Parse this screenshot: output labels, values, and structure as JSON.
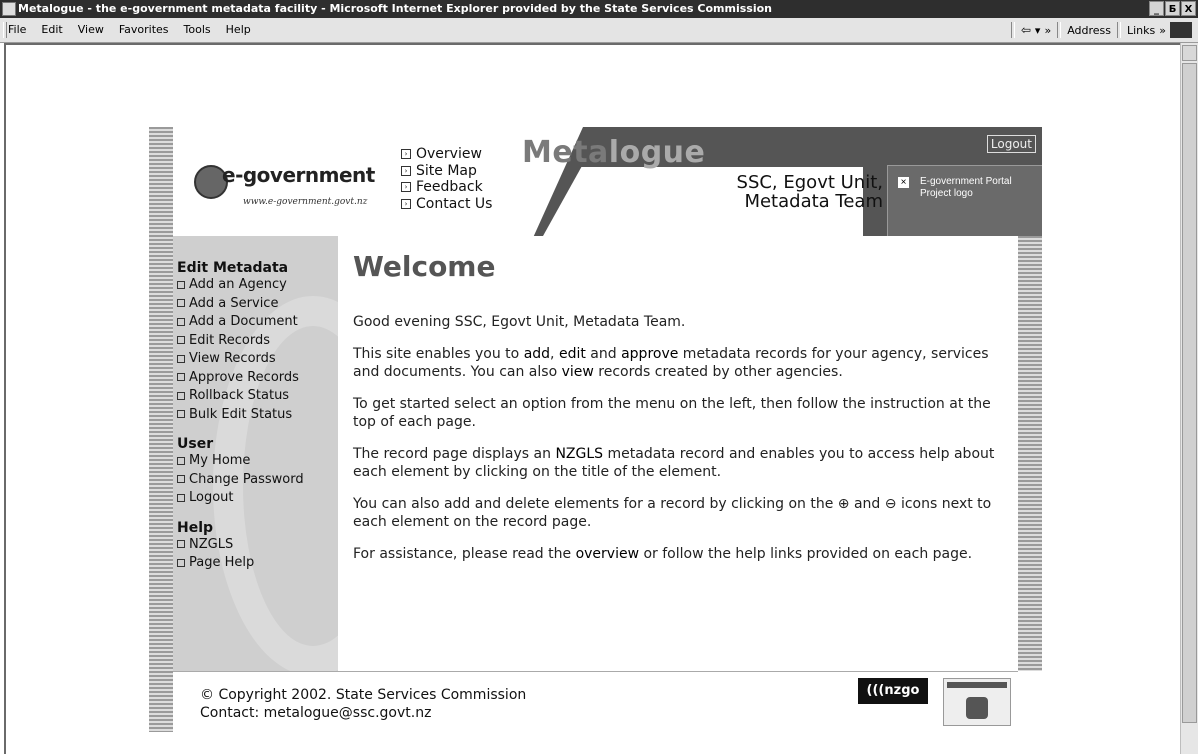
{
  "window": {
    "title": "Metalogue - the e-government metadata facility - Microsoft Internet Explorer provided by the State Services Commission",
    "controls": [
      "_",
      "Б",
      "X"
    ]
  },
  "menubar": {
    "items": [
      "File",
      "Edit",
      "View",
      "Favorites",
      "Tools",
      "Help"
    ],
    "back_label": "⇦",
    "back_dropdown": "▾",
    "more_label": "»",
    "address_label": "Address",
    "links_label": "Links",
    "links_more": "»"
  },
  "header": {
    "logo_word": "e-government",
    "logo_url": "www.e-government.govt.nz",
    "nav": [
      "Overview",
      "Site Map",
      "Feedback",
      "Contact Us"
    ],
    "brand_part1": "Meta",
    "brand_part2": "logue",
    "user_line1": "SSC, Egovt Unit,",
    "user_line2": "Metadata Team",
    "logout_label": "Logout",
    "portal_logo_alt": "E-government Portal Project logo",
    "broken_image_glyph": "×"
  },
  "sidebar": {
    "sections": [
      {
        "title": "Edit Metadata",
        "items": [
          "Add an Agency",
          "Add a Service",
          "Add a Document",
          "Edit Records",
          "View Records",
          "Approve Records",
          "Rollback Status",
          "Bulk Edit Status"
        ]
      },
      {
        "title": "User",
        "items": [
          "My Home",
          "Change Password",
          "Logout"
        ]
      },
      {
        "title": "Help",
        "items": [
          "NZGLS",
          "Page Help"
        ]
      }
    ]
  },
  "main": {
    "heading": "Welcome",
    "greeting": "Good evening SSC, Egovt Unit, Metadata Team.",
    "p1_a": "This site enables you to ",
    "p1_add": "add",
    "p1_b": ", ",
    "p1_edit": "edit",
    "p1_c": " and ",
    "p1_approve": "approve",
    "p1_d": " metadata records for your agency, services and documents. You can also ",
    "p1_view": "view",
    "p1_e": " records created by other agencies.",
    "p2": "To get started select an option from the menu on the left, then follow the instruction at the top of each page.",
    "p3_a": "The record page displays an ",
    "p3_nzgls": "NZGLS",
    "p3_b": " metadata record and enables you to access help about each element by clicking on the title of the element.",
    "p4": "You can also add and delete elements for a record by clicking on the ⊕ and ⊖ icons next to each element on the record page.",
    "p5_a": "For assistance, please read the ",
    "p5_overview": "overview",
    "p5_b": " or follow the help links provided on each page."
  },
  "footer": {
    "copyright": "© Copyright 2002. State Services Commission",
    "contact": "Contact: metalogue@ssc.govt.nz",
    "nzgo_label": "(((nzgo"
  }
}
